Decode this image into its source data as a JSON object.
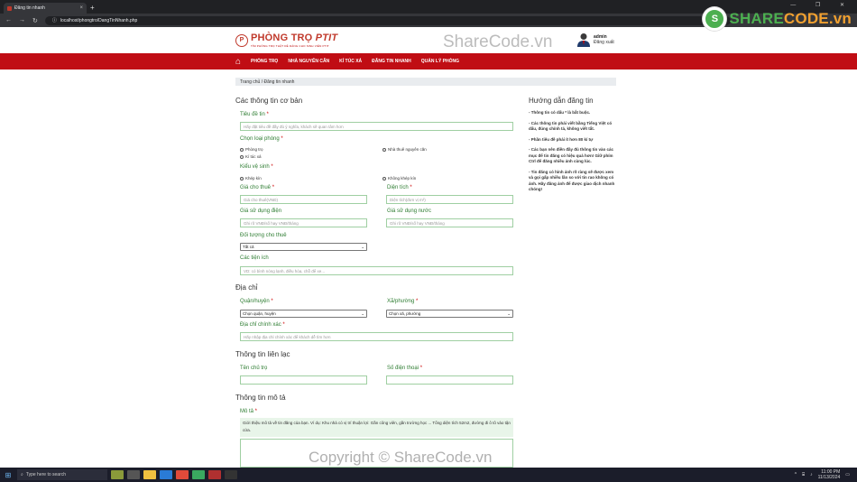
{
  "browser": {
    "tab_title": "Đăng tin nhanh",
    "tab_close": "×",
    "new_tab": "+",
    "window_controls": "— ❐ ✕",
    "url": "localhost/phongtro/DangTinNhanh.php"
  },
  "watermarks": {
    "top": "ShareCode.vn",
    "bottom": "Copyright © ShareCode.vn",
    "brand_left": "SHARE",
    "brand_right": "CODE.vn"
  },
  "header": {
    "logo_title_a": "PHÒNG TRỌ ",
    "logo_title_b": "PTIT",
    "logo_subtitle": "TÌM PHÒNG TRỌ THẬT DỄ DÀNG CHO SINH VIÊN PTIT",
    "user_name": "admin",
    "logout": "Đăng xuất"
  },
  "nav": {
    "items": [
      "PHÒNG TRỌ",
      "NHÀ NGUYÊN CĂN",
      "KÍ TÚC XÁ",
      "ĐĂNG TIN NHANH",
      "QUẢN LÝ PHÒNG"
    ]
  },
  "breadcrumb": "Trang chủ / Đăng tin nhanh",
  "sections": {
    "basic": "Các thông tin cơ bản",
    "address": "Địa chỉ",
    "contact": "Thông tin liên lạc",
    "description": "Thông tin mô tả"
  },
  "form": {
    "title_label": "Tiêu đề tin",
    "title_placeholder": "Hãy đặt tiêu đề đầy đủ ý nghĩa, khách sẽ quan tâm hơn",
    "room_type_label": "Chọn loại phòng",
    "room_types": [
      "Phòng trọ",
      "Nhà thuê nguyên căn",
      "Kí túc xá"
    ],
    "wc_label": "Kiểu vệ sinh",
    "wc_types": [
      "Khép kín",
      "Không khép kín"
    ],
    "price_label": "Giá cho thuê",
    "price_placeholder": "Giá cho thuê(VNĐ)",
    "area_label": "Diện tích",
    "area_placeholder": "Diện tích(đơn vị m²)",
    "electric_label": "Giá sử dụng điện",
    "electric_placeholder": "Ghi rõ VNĐ/số hay VNĐ/tháng",
    "water_label": "Giá sử dụng nước",
    "water_placeholder": "Ghi rõ VNĐ/số hay VNĐ/tháng",
    "target_label": "Đối tượng cho thuê",
    "target_value": "Tất cả",
    "utilities_label": "Các tiện ích",
    "utilities_placeholder": "VD: có bình nóng lạnh, điều hòa, chỗ để xe...",
    "district_label": "Quận/huyện",
    "district_value": "Chọn quận, huyện",
    "ward_label": "Xã/phường",
    "ward_value": "Chọn xã, phường",
    "address_label": "Địa chỉ chính xác",
    "address_placeholder": "Hãy nhập địa chỉ chính xác để khách dễ tìm hơn",
    "owner_label": "Tên chủ trọ",
    "phone_label": "Số điện thoại",
    "desc_label": "Mô tả",
    "desc_hint": "Giới thiệu mô tả về tin đăng của bạn. Ví dụ: Khu nhà có vị trí thuận lợi: Gần công viên, gần trường học ... Tổng diện tích 52m2, đường đi ô tô vào tận cửa.",
    "required_mark": " *"
  },
  "sidebar": {
    "title": "Hướng dẫn đăng tin",
    "items": [
      "- Thông tin có dấu * là bắt buộc.",
      "- Các thông tin phải viết bằng Tiếng Việt có dấu, đúng chính tả, không viết tắt.",
      "- Phần tiêu đề phải ít hơn 80 kí tự",
      "- Các bạn nên điền đầy đủ thông tin vào các mục để tin đăng có hiệu quả hơn! Giữ phím Ctrl để đăng nhiều ảnh cùng lúc.",
      "- Tin đăng có hình ảnh rõ ràng sẽ được xem và gọi gấp nhiều lần so với tin rao không có ảnh. Hãy đăng ảnh để được giao dịch nhanh chóng!"
    ]
  },
  "taskbar": {
    "search": "Type here to search",
    "time": "11:00 PM",
    "date": "11/13/2024"
  }
}
